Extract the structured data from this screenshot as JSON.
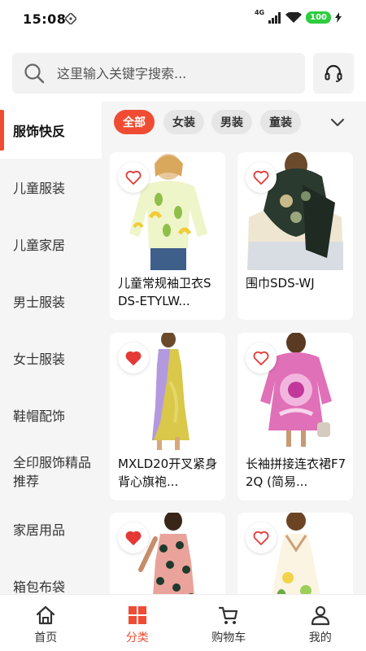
{
  "status_bar": {
    "time": "15:08",
    "network": "4G",
    "battery": "100"
  },
  "search": {
    "placeholder": "这里输入关键字搜索..."
  },
  "sidebar": {
    "items": [
      {
        "label": "服饰快反",
        "active": true
      },
      {
        "label": "儿童服装",
        "active": false
      },
      {
        "label": "儿童家居",
        "active": false
      },
      {
        "label": "男士服装",
        "active": false
      },
      {
        "label": "女士服装",
        "active": false
      },
      {
        "label": "鞋帽配饰",
        "active": false
      },
      {
        "label": "全印服饰精品推荐",
        "active": false
      },
      {
        "label": "家居用品",
        "active": false
      },
      {
        "label": "箱包布袋",
        "active": false
      }
    ]
  },
  "filters": {
    "chips": [
      {
        "label": "全部",
        "active": true
      },
      {
        "label": "女装",
        "active": false
      },
      {
        "label": "男装",
        "active": false
      },
      {
        "label": "童装",
        "active": false
      }
    ]
  },
  "products": [
    {
      "title": "儿童常规袖卫衣SDS-ETYLW...",
      "favorited": false
    },
    {
      "title": "围巾SDS-WJ",
      "favorited": false
    },
    {
      "title": "MXLD20开叉紧身背心旗袍...",
      "favorited": true
    },
    {
      "title": "长袖拼接连衣裙F72Q (简易...",
      "favorited": false
    },
    {
      "title": "",
      "favorited": true
    },
    {
      "title": "",
      "favorited": false
    }
  ],
  "tabbar": {
    "tabs": [
      {
        "label": "首页",
        "icon": "home-icon",
        "active": false
      },
      {
        "label": "分类",
        "icon": "category-icon",
        "active": true
      },
      {
        "label": "购物车",
        "icon": "cart-icon",
        "active": false
      },
      {
        "label": "我的",
        "icon": "profile-icon",
        "active": false
      }
    ]
  },
  "colors": {
    "accent": "#f04c33",
    "fav_active": "#e53935"
  }
}
